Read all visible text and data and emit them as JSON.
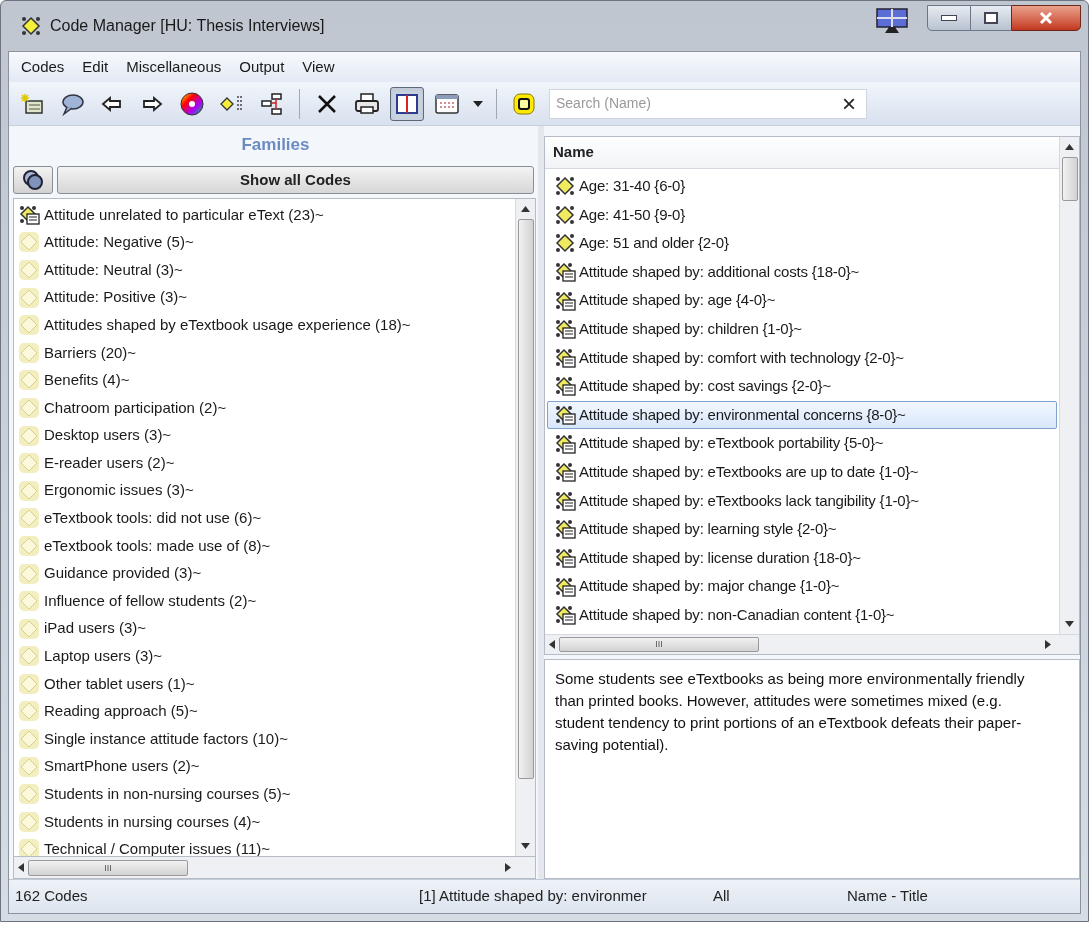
{
  "window": {
    "title": "Code Manager [HU: Thesis Interviews]"
  },
  "menu": [
    "Codes",
    "Edit",
    "Miscellaneous",
    "Output",
    "View"
  ],
  "toolbar": [
    {
      "kind": "new-code"
    },
    {
      "kind": "comment"
    },
    {
      "kind": "back"
    },
    {
      "kind": "forward"
    },
    {
      "kind": "color"
    },
    {
      "kind": "code-list"
    },
    {
      "kind": "network"
    },
    {
      "kind": "separator"
    },
    {
      "kind": "delete"
    },
    {
      "kind": "print"
    },
    {
      "kind": "split-view",
      "pressed": true
    },
    {
      "kind": "grid-view"
    },
    {
      "kind": "dropdown"
    },
    {
      "kind": "separator"
    },
    {
      "kind": "filter"
    }
  ],
  "search": {
    "placeholder": "Search (Name)",
    "clear": "×"
  },
  "families": {
    "title": "Families",
    "show_all": "Show all Codes",
    "items": [
      {
        "kind": "commented",
        "label": "Attitude unrelated to particular eText (23)~"
      },
      {
        "kind": "family",
        "label": "Attitude: Negative (5)~"
      },
      {
        "kind": "family",
        "label": "Attitude: Neutral (3)~"
      },
      {
        "kind": "family",
        "label": "Attitude: Positive (3)~"
      },
      {
        "kind": "family",
        "label": "Attitudes shaped by eTextbook usage experience (18)~"
      },
      {
        "kind": "family",
        "label": "Barriers (20)~"
      },
      {
        "kind": "family",
        "label": "Benefits (4)~"
      },
      {
        "kind": "family",
        "label": "Chatroom participation (2)~"
      },
      {
        "kind": "family",
        "label": "Desktop users (3)~"
      },
      {
        "kind": "family",
        "label": "E-reader users (2)~"
      },
      {
        "kind": "family",
        "label": "Ergonomic issues (3)~"
      },
      {
        "kind": "family",
        "label": "eTextbook tools: did not use (6)~"
      },
      {
        "kind": "family",
        "label": "eTextbook tools: made use of (8)~"
      },
      {
        "kind": "family",
        "label": "Guidance provided (3)~"
      },
      {
        "kind": "family",
        "label": "Influence of fellow students (2)~"
      },
      {
        "kind": "family",
        "label": "iPad users (3)~"
      },
      {
        "kind": "family",
        "label": "Laptop users (3)~"
      },
      {
        "kind": "family",
        "label": "Other tablet users (1)~"
      },
      {
        "kind": "family",
        "label": "Reading approach (5)~"
      },
      {
        "kind": "family",
        "label": "Single instance attitude factors (10)~"
      },
      {
        "kind": "family",
        "label": "SmartPhone users (2)~"
      },
      {
        "kind": "family",
        "label": "Students in non-nursing courses (5)~"
      },
      {
        "kind": "family",
        "label": "Students in nursing courses (4)~"
      },
      {
        "kind": "family",
        "label": "Technical / Computer issues (11)~"
      }
    ],
    "hscroll_grip": "III"
  },
  "codes": {
    "column": "Name",
    "hscroll_grip": "III",
    "items": [
      {
        "kind": "code",
        "label": "Age: 31-40 {6-0}",
        "selected": false
      },
      {
        "kind": "code",
        "label": "Age: 41-50 {9-0}",
        "selected": false
      },
      {
        "kind": "code",
        "label": "Age: 51 and older {2-0}",
        "selected": false
      },
      {
        "kind": "commented",
        "label": "Attitude shaped by: additional costs {18-0}~",
        "selected": false
      },
      {
        "kind": "commented",
        "label": "Attitude shaped by: age {4-0}~",
        "selected": false
      },
      {
        "kind": "commented",
        "label": "Attitude shaped by: children {1-0}~",
        "selected": false
      },
      {
        "kind": "commented",
        "label": "Attitude shaped by: comfort with technology {2-0}~",
        "selected": false
      },
      {
        "kind": "commented",
        "label": "Attitude shaped by: cost savings {2-0}~",
        "selected": false
      },
      {
        "kind": "commented",
        "label": "Attitude shaped by: environmental concerns {8-0}~",
        "selected": true
      },
      {
        "kind": "commented",
        "label": "Attitude shaped by: eTextbook portability {5-0}~",
        "selected": false
      },
      {
        "kind": "commented",
        "label": "Attitude shaped by: eTextbooks are up to date {1-0}~",
        "selected": false
      },
      {
        "kind": "commented",
        "label": "Attitude shaped by: eTextbooks lack tangibility {1-0}~",
        "selected": false
      },
      {
        "kind": "commented",
        "label": "Attitude shaped by: learning style {2-0}~",
        "selected": false
      },
      {
        "kind": "commented",
        "label": "Attitude shaped by: license duration {18-0}~",
        "selected": false
      },
      {
        "kind": "commented",
        "label": "Attitude shaped by: major change {1-0}~",
        "selected": false
      },
      {
        "kind": "commented",
        "label": "Attitude shaped by: non-Canadian content {1-0}~",
        "selected": false
      }
    ]
  },
  "comment": "Some students see eTextbooks as being more environmentally friendly than printed books.  However, attitudes were sometimes mixed (e.g. student tendency to print portions of an eTextbook defeats their paper-saving potential).",
  "status_bar": {
    "count": "162 Codes",
    "selection": "[1] Attitude shaped by: environmer",
    "filter": "All",
    "sort": "Name - Title"
  }
}
